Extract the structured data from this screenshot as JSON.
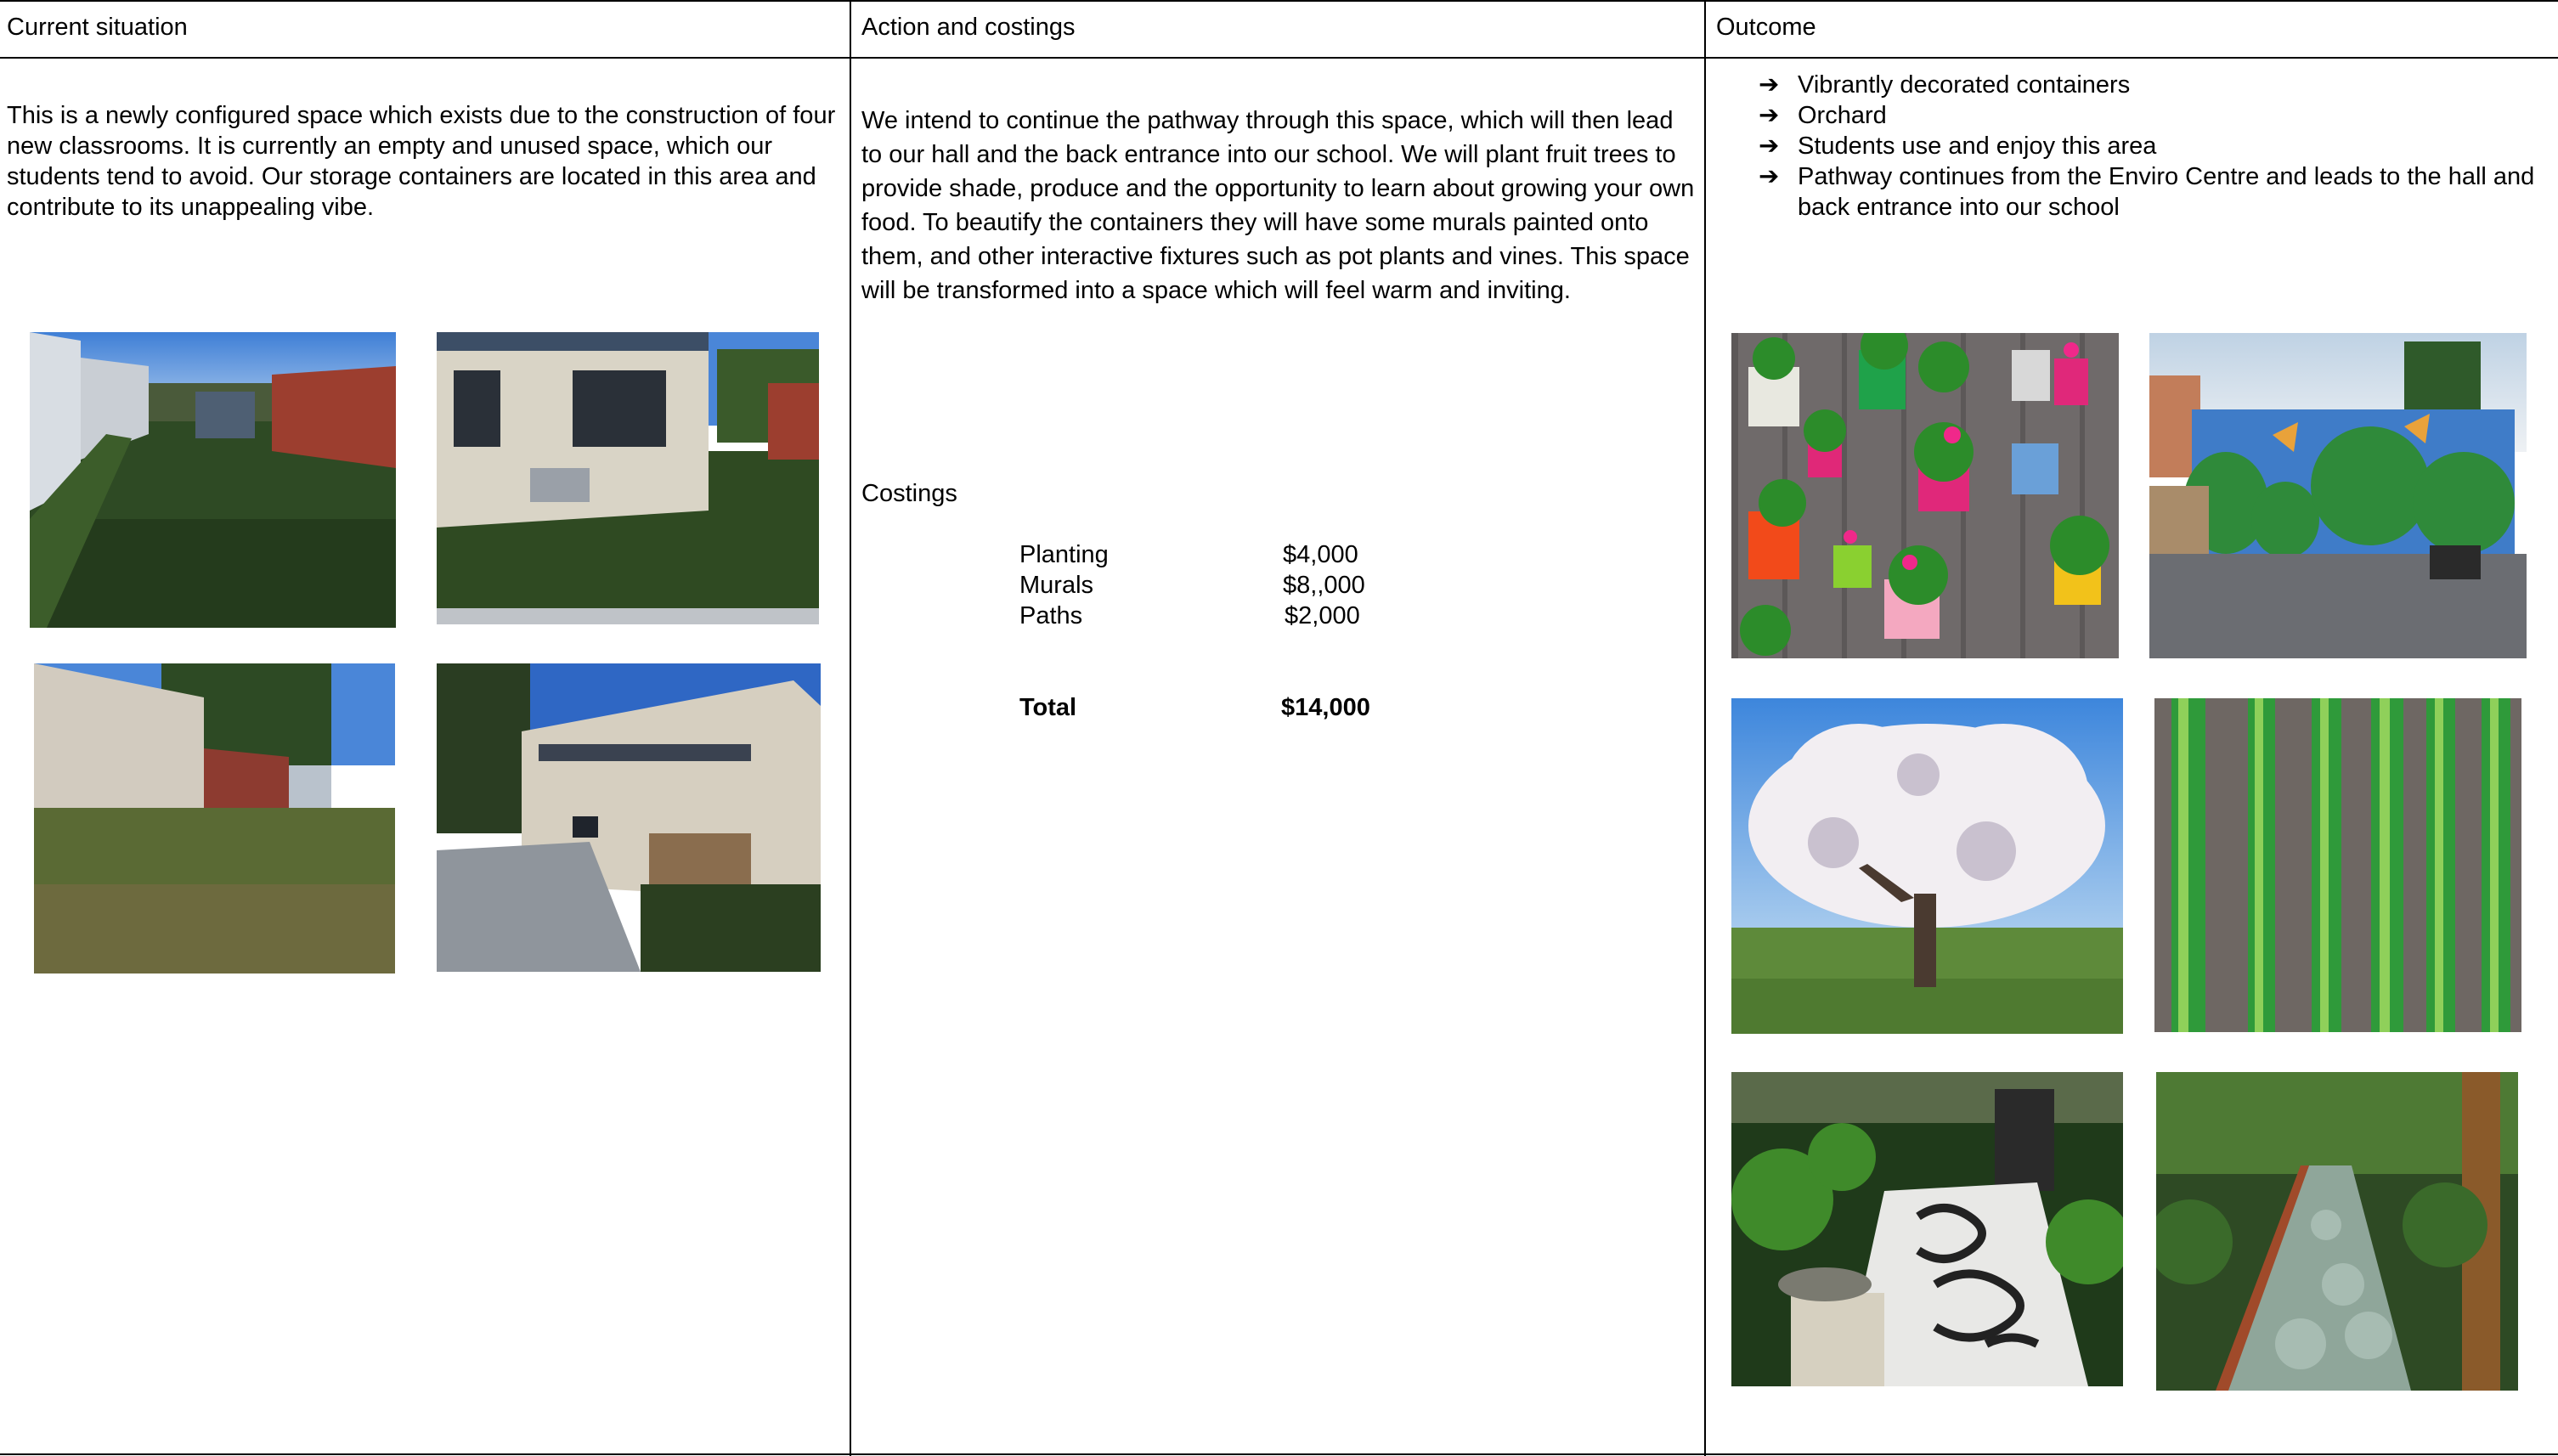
{
  "columns": {
    "current": {
      "header": "Current situation",
      "description": "This is a newly configured space which exists due to the construction of four new classrooms. It is currently an empty and unused space, which our students tend to avoid. Our storage containers are located in this area and contribute to its unappealing vibe."
    },
    "action": {
      "header": "Action and costings",
      "description": "We intend to continue the pathway through this space, which will then lead to our hall and the back entrance into our school. We will plant fruit trees to provide shade, produce and the opportunity to learn about growing your own food. To beautify the containers they will have some murals painted onto them, and other interactive fixtures such as pot plants and vines. This space will be transformed into a space which will feel warm and inviting.",
      "costings_heading": "Costings",
      "costs": [
        {
          "item": "Planting",
          "amount": "$4,000"
        },
        {
          "item": "Murals",
          "amount": "$8,,000"
        },
        {
          "item": "Paths",
          "amount": "$2,000"
        }
      ],
      "total": {
        "label": "Total",
        "amount": "$14,000"
      }
    },
    "outcome": {
      "header": "Outcome",
      "bullet_icon": "arrow-right-icon",
      "bullets": [
        "Vibrantly decorated containers",
        "Orchard",
        "Students use and enjoy this area",
        "Pathway continues from the Enviro Centre and leads to the hall and back entrance into our school"
      ]
    }
  }
}
